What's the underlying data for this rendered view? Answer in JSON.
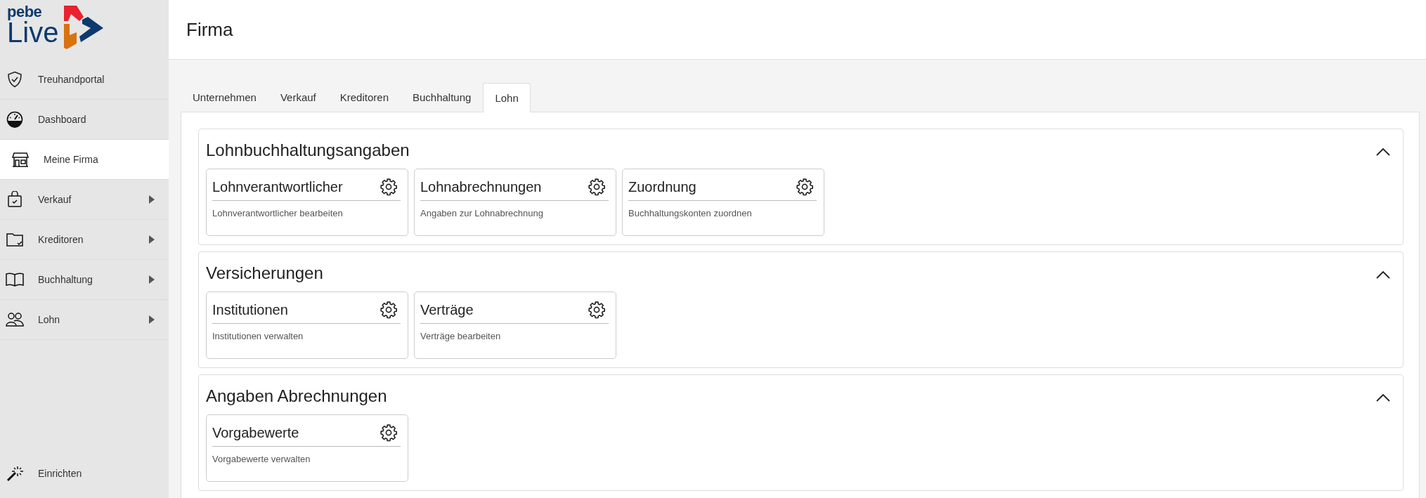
{
  "logo": {
    "line1": "pebe",
    "line2": "Live"
  },
  "sidebar": {
    "items": [
      {
        "label": "Treuhandportal",
        "selected": false,
        "has_submenu": false
      },
      {
        "label": "Dashboard",
        "selected": false,
        "has_submenu": false
      },
      {
        "label": "Meine Firma",
        "selected": true,
        "has_submenu": false
      },
      {
        "label": "Verkauf",
        "selected": false,
        "has_submenu": true
      },
      {
        "label": "Kreditoren",
        "selected": false,
        "has_submenu": true
      },
      {
        "label": "Buchhaltung",
        "selected": false,
        "has_submenu": true
      },
      {
        "label": "Lohn",
        "selected": false,
        "has_submenu": true
      }
    ],
    "footer_item": {
      "label": "Einrichten"
    }
  },
  "page": {
    "title": "Firma"
  },
  "tabs": [
    {
      "label": "Unternehmen",
      "selected": false
    },
    {
      "label": "Verkauf",
      "selected": false
    },
    {
      "label": "Kreditoren",
      "selected": false
    },
    {
      "label": "Buchhaltung",
      "selected": false
    },
    {
      "label": "Lohn",
      "selected": true
    }
  ],
  "sections": [
    {
      "title": "Lohnbuchhaltungsangaben",
      "expanded": true,
      "cards": [
        {
          "title": "Lohnverantwortlicher",
          "description": "Lohnverantwortlicher bearbeiten"
        },
        {
          "title": "Lohnabrechnungen",
          "description": "Angaben zur Lohnabrechnung"
        },
        {
          "title": "Zuordnung",
          "description": "Buchhaltungskonten zuordnen"
        }
      ]
    },
    {
      "title": "Versicherungen",
      "expanded": true,
      "cards": [
        {
          "title": "Institutionen",
          "description": "Institutionen verwalten"
        },
        {
          "title": "Verträge",
          "description": "Verträge bearbeiten"
        }
      ]
    },
    {
      "title": "Angaben Abrechnungen",
      "expanded": true,
      "cards": [
        {
          "title": "Vorgabewerte",
          "description": "Vorgabewerte verwalten"
        }
      ]
    }
  ]
}
